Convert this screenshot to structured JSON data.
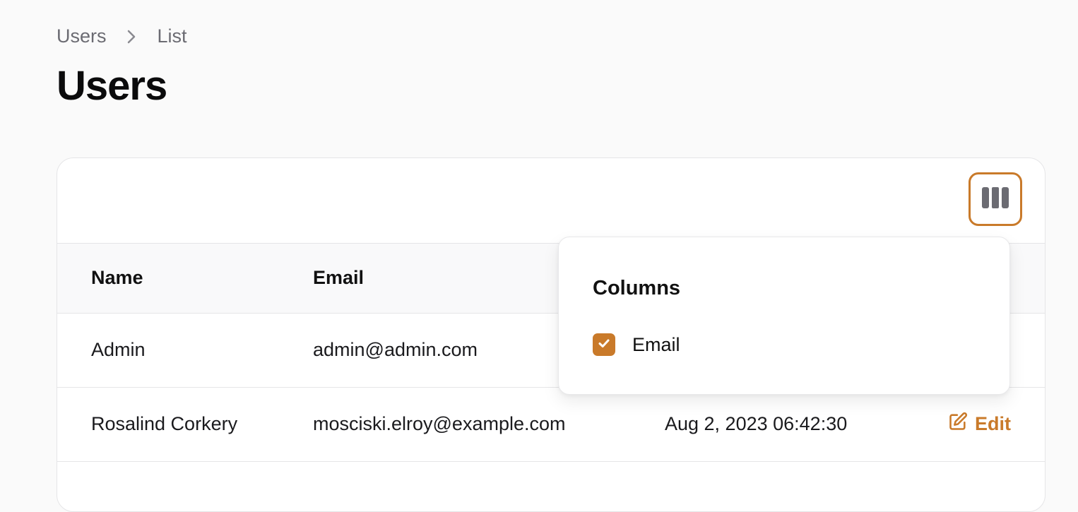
{
  "breadcrumb": {
    "items": [
      "Users",
      "List"
    ]
  },
  "page": {
    "title": "Users"
  },
  "colors": {
    "accent": "#c97a2a",
    "background": "#fafafa",
    "muted_text": "#6b6b72"
  },
  "toolbar": {
    "columns_toggle_icon": "columns-icon"
  },
  "table": {
    "headers": [
      "Name",
      "Email"
    ],
    "rows": [
      {
        "name": "Admin",
        "email": "admin@admin.com",
        "date": "",
        "action": ""
      },
      {
        "name": "Rosalind Corkery",
        "email": "mosciski.elroy@example.com",
        "date": "Aug 2, 2023 06:42:30",
        "action": "Edit"
      }
    ]
  },
  "columns_popover": {
    "title": "Columns",
    "options": [
      {
        "label": "Email",
        "checked": true
      }
    ]
  }
}
